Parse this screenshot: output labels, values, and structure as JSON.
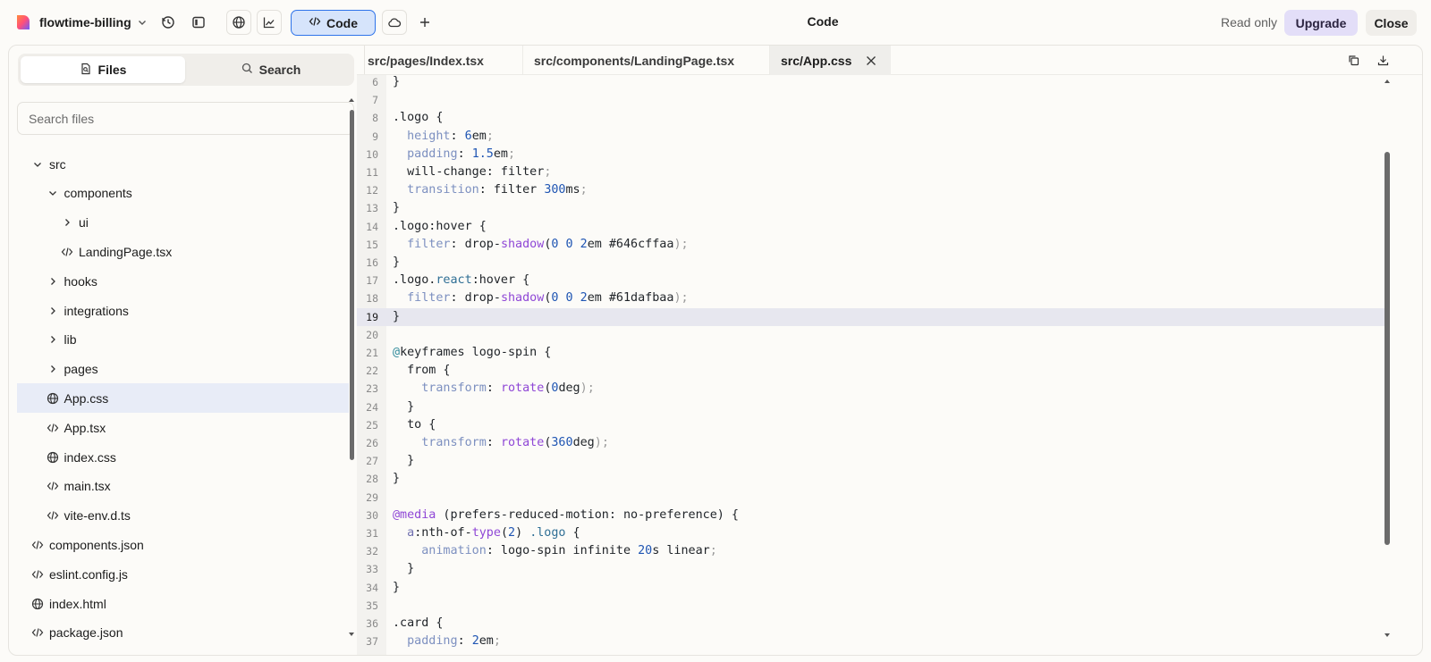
{
  "topbar": {
    "project_name": "flowtime-billing",
    "code_label": "Code",
    "center_title": "Code",
    "read_only": "Read only",
    "upgrade": "Upgrade",
    "close": "Close"
  },
  "sidebar": {
    "tabs": {
      "files": "Files",
      "search": "Search"
    },
    "search_placeholder": "Search files",
    "tree": [
      {
        "label": "src",
        "kind": "folder-open"
      },
      {
        "label": "components",
        "kind": "folder-open"
      },
      {
        "label": "ui",
        "kind": "folder-closed"
      },
      {
        "label": "LandingPage.tsx",
        "kind": "code-file"
      },
      {
        "label": "hooks",
        "kind": "folder-closed"
      },
      {
        "label": "integrations",
        "kind": "folder-closed"
      },
      {
        "label": "lib",
        "kind": "folder-closed"
      },
      {
        "label": "pages",
        "kind": "folder-closed"
      },
      {
        "label": "App.css",
        "kind": "globe-file",
        "selected": true
      },
      {
        "label": "App.tsx",
        "kind": "code-file"
      },
      {
        "label": "index.css",
        "kind": "globe-file"
      },
      {
        "label": "main.tsx",
        "kind": "code-file"
      },
      {
        "label": "vite-env.d.ts",
        "kind": "code-file"
      },
      {
        "label": "components.json",
        "kind": "code-file"
      },
      {
        "label": "eslint.config.js",
        "kind": "code-file"
      },
      {
        "label": "index.html",
        "kind": "globe-file"
      },
      {
        "label": "package.json",
        "kind": "code-file"
      }
    ]
  },
  "editor": {
    "tabs": [
      "src/pages/Index.tsx",
      "src/components/LandingPage.tsx",
      "src/App.css"
    ],
    "active_tab": "src/App.css",
    "highlighted_line": "19",
    "lines": [
      {
        "n": "6",
        "code": "}"
      },
      {
        "n": "7",
        "code": ""
      },
      {
        "n": "8",
        "code": ".logo {"
      },
      {
        "n": "9",
        "code": "  height: 6em;"
      },
      {
        "n": "10",
        "code": "  padding: 1.5em;"
      },
      {
        "n": "11",
        "code": "  will-change: filter;"
      },
      {
        "n": "12",
        "code": "  transition: filter 300ms;"
      },
      {
        "n": "13",
        "code": "}"
      },
      {
        "n": "14",
        "code": ".logo:hover {"
      },
      {
        "n": "15",
        "code": "  filter: drop-shadow(0 0 2em #646cffaa);"
      },
      {
        "n": "16",
        "code": "}"
      },
      {
        "n": "17",
        "code": ".logo.react:hover {"
      },
      {
        "n": "18",
        "code": "  filter: drop-shadow(0 0 2em #61dafbaa);"
      },
      {
        "n": "19",
        "code": "}"
      },
      {
        "n": "20",
        "code": ""
      },
      {
        "n": "21",
        "code": "@keyframes logo-spin {"
      },
      {
        "n": "22",
        "code": "  from {"
      },
      {
        "n": "23",
        "code": "    transform: rotate(0deg);"
      },
      {
        "n": "24",
        "code": "  }"
      },
      {
        "n": "25",
        "code": "  to {"
      },
      {
        "n": "26",
        "code": "    transform: rotate(360deg);"
      },
      {
        "n": "27",
        "code": "  }"
      },
      {
        "n": "28",
        "code": "}"
      },
      {
        "n": "29",
        "code": ""
      },
      {
        "n": "30",
        "code": "@media (prefers-reduced-motion: no-preference) {"
      },
      {
        "n": "31",
        "code": "  a:nth-of-type(2) .logo {"
      },
      {
        "n": "32",
        "code": "    animation: logo-spin infinite 20s linear;"
      },
      {
        "n": "33",
        "code": "  }"
      },
      {
        "n": "34",
        "code": "}"
      },
      {
        "n": "35",
        "code": ""
      },
      {
        "n": "36",
        "code": ".card {"
      },
      {
        "n": "37",
        "code": "  padding: 2em;"
      }
    ]
  },
  "colors": {
    "accent_blue": "#2f74ea",
    "upgrade_bg": "#e3def8",
    "selected_row": "#e8ecf7",
    "highlight_line": "#e7e7ef"
  }
}
